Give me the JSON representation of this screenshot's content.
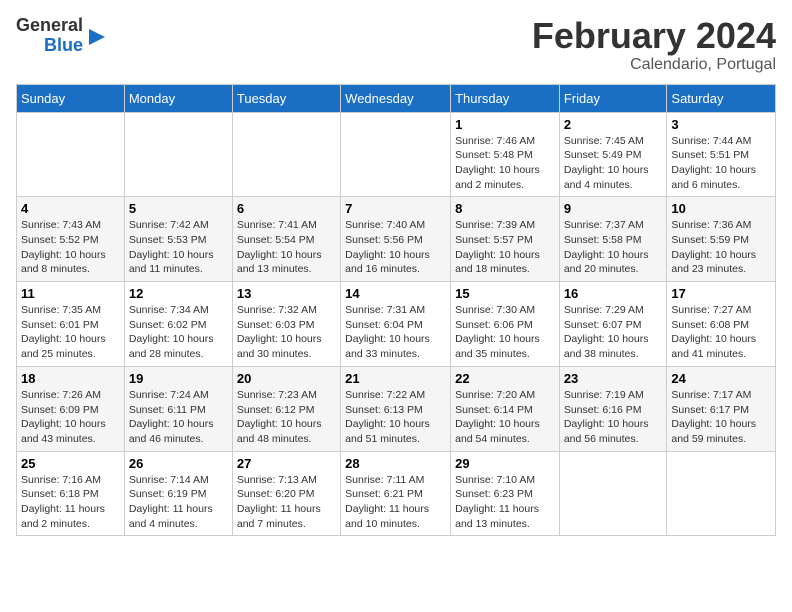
{
  "header": {
    "logo_line1": "General",
    "logo_line2": "Blue",
    "title": "February 2024",
    "subtitle": "Calendario, Portugal"
  },
  "weekdays": [
    "Sunday",
    "Monday",
    "Tuesday",
    "Wednesday",
    "Thursday",
    "Friday",
    "Saturday"
  ],
  "weeks": [
    [
      {
        "day": "",
        "info": ""
      },
      {
        "day": "",
        "info": ""
      },
      {
        "day": "",
        "info": ""
      },
      {
        "day": "",
        "info": ""
      },
      {
        "day": "1",
        "info": "Sunrise: 7:46 AM\nSunset: 5:48 PM\nDaylight: 10 hours and 2 minutes."
      },
      {
        "day": "2",
        "info": "Sunrise: 7:45 AM\nSunset: 5:49 PM\nDaylight: 10 hours and 4 minutes."
      },
      {
        "day": "3",
        "info": "Sunrise: 7:44 AM\nSunset: 5:51 PM\nDaylight: 10 hours and 6 minutes."
      }
    ],
    [
      {
        "day": "4",
        "info": "Sunrise: 7:43 AM\nSunset: 5:52 PM\nDaylight: 10 hours and 8 minutes."
      },
      {
        "day": "5",
        "info": "Sunrise: 7:42 AM\nSunset: 5:53 PM\nDaylight: 10 hours and 11 minutes."
      },
      {
        "day": "6",
        "info": "Sunrise: 7:41 AM\nSunset: 5:54 PM\nDaylight: 10 hours and 13 minutes."
      },
      {
        "day": "7",
        "info": "Sunrise: 7:40 AM\nSunset: 5:56 PM\nDaylight: 10 hours and 16 minutes."
      },
      {
        "day": "8",
        "info": "Sunrise: 7:39 AM\nSunset: 5:57 PM\nDaylight: 10 hours and 18 minutes."
      },
      {
        "day": "9",
        "info": "Sunrise: 7:37 AM\nSunset: 5:58 PM\nDaylight: 10 hours and 20 minutes."
      },
      {
        "day": "10",
        "info": "Sunrise: 7:36 AM\nSunset: 5:59 PM\nDaylight: 10 hours and 23 minutes."
      }
    ],
    [
      {
        "day": "11",
        "info": "Sunrise: 7:35 AM\nSunset: 6:01 PM\nDaylight: 10 hours and 25 minutes."
      },
      {
        "day": "12",
        "info": "Sunrise: 7:34 AM\nSunset: 6:02 PM\nDaylight: 10 hours and 28 minutes."
      },
      {
        "day": "13",
        "info": "Sunrise: 7:32 AM\nSunset: 6:03 PM\nDaylight: 10 hours and 30 minutes."
      },
      {
        "day": "14",
        "info": "Sunrise: 7:31 AM\nSunset: 6:04 PM\nDaylight: 10 hours and 33 minutes."
      },
      {
        "day": "15",
        "info": "Sunrise: 7:30 AM\nSunset: 6:06 PM\nDaylight: 10 hours and 35 minutes."
      },
      {
        "day": "16",
        "info": "Sunrise: 7:29 AM\nSunset: 6:07 PM\nDaylight: 10 hours and 38 minutes."
      },
      {
        "day": "17",
        "info": "Sunrise: 7:27 AM\nSunset: 6:08 PM\nDaylight: 10 hours and 41 minutes."
      }
    ],
    [
      {
        "day": "18",
        "info": "Sunrise: 7:26 AM\nSunset: 6:09 PM\nDaylight: 10 hours and 43 minutes."
      },
      {
        "day": "19",
        "info": "Sunrise: 7:24 AM\nSunset: 6:11 PM\nDaylight: 10 hours and 46 minutes."
      },
      {
        "day": "20",
        "info": "Sunrise: 7:23 AM\nSunset: 6:12 PM\nDaylight: 10 hours and 48 minutes."
      },
      {
        "day": "21",
        "info": "Sunrise: 7:22 AM\nSunset: 6:13 PM\nDaylight: 10 hours and 51 minutes."
      },
      {
        "day": "22",
        "info": "Sunrise: 7:20 AM\nSunset: 6:14 PM\nDaylight: 10 hours and 54 minutes."
      },
      {
        "day": "23",
        "info": "Sunrise: 7:19 AM\nSunset: 6:16 PM\nDaylight: 10 hours and 56 minutes."
      },
      {
        "day": "24",
        "info": "Sunrise: 7:17 AM\nSunset: 6:17 PM\nDaylight: 10 hours and 59 minutes."
      }
    ],
    [
      {
        "day": "25",
        "info": "Sunrise: 7:16 AM\nSunset: 6:18 PM\nDaylight: 11 hours and 2 minutes."
      },
      {
        "day": "26",
        "info": "Sunrise: 7:14 AM\nSunset: 6:19 PM\nDaylight: 11 hours and 4 minutes."
      },
      {
        "day": "27",
        "info": "Sunrise: 7:13 AM\nSunset: 6:20 PM\nDaylight: 11 hours and 7 minutes."
      },
      {
        "day": "28",
        "info": "Sunrise: 7:11 AM\nSunset: 6:21 PM\nDaylight: 11 hours and 10 minutes."
      },
      {
        "day": "29",
        "info": "Sunrise: 7:10 AM\nSunset: 6:23 PM\nDaylight: 11 hours and 13 minutes."
      },
      {
        "day": "",
        "info": ""
      },
      {
        "day": "",
        "info": ""
      }
    ]
  ]
}
